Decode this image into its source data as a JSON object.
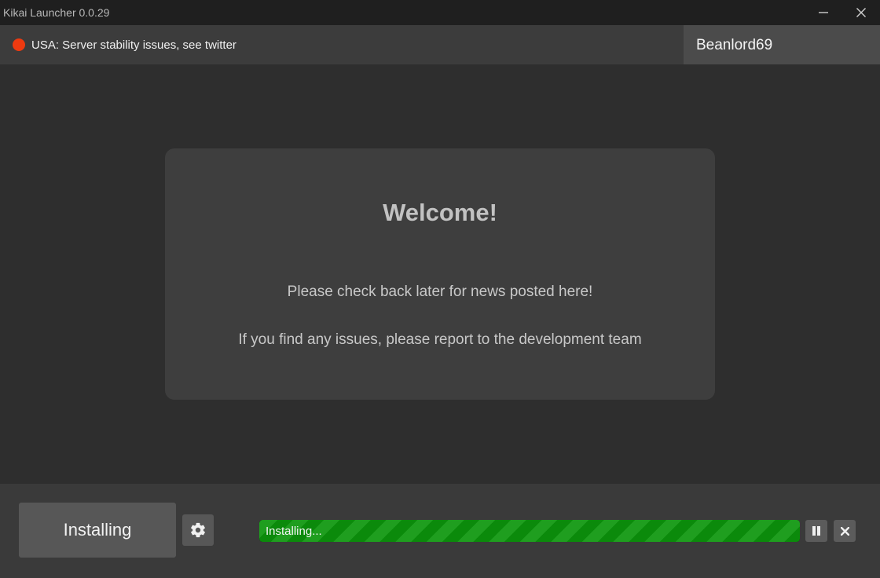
{
  "window": {
    "title": "Kikai Launcher 0.0.29",
    "minimize_icon": "minimize-icon",
    "close_icon": "close-icon"
  },
  "status": {
    "indicator_color": "#ee3a10",
    "message": "USA: Server stability issues, see twitter",
    "username": "Beanlord69"
  },
  "news": {
    "title": "Welcome!",
    "lines": [
      "Please check back later for news posted here!",
      "If you find any issues, please report to the development team"
    ]
  },
  "footer": {
    "install_label": "Installing",
    "settings_icon": "gear-icon",
    "progress": {
      "label": "Installing...",
      "fraction": 1.0,
      "color": "#0b8a0b"
    },
    "pause_icon": "pause-icon",
    "cancel_icon": "close-icon"
  }
}
